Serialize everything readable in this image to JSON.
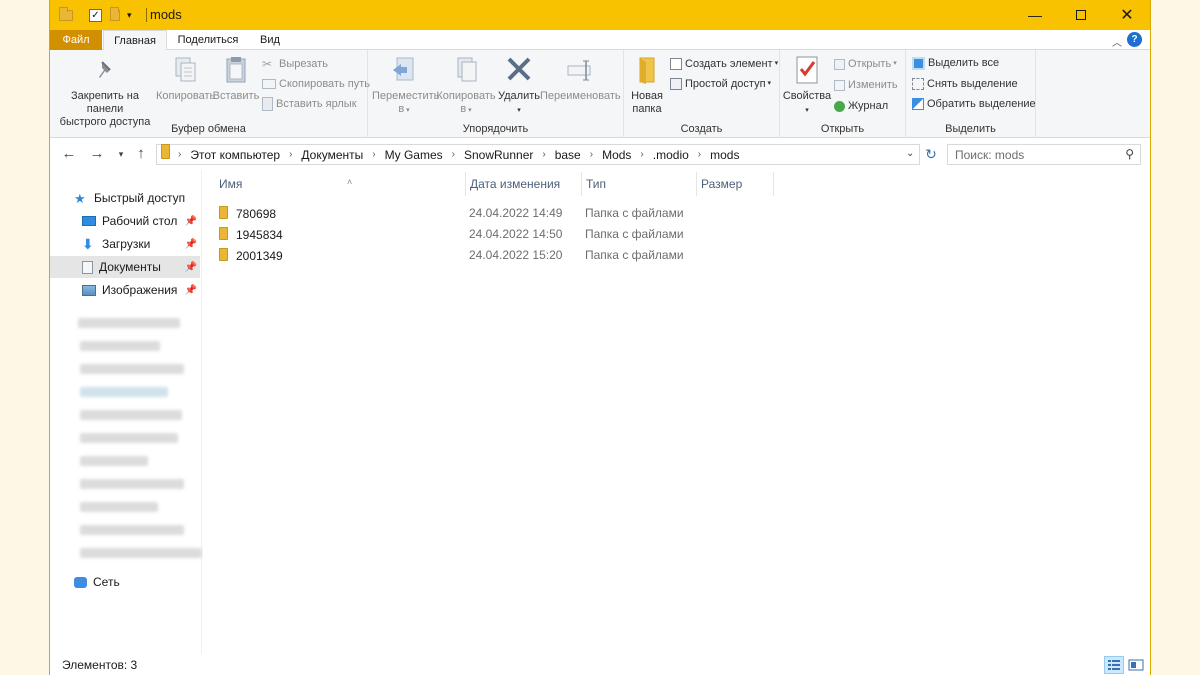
{
  "window": {
    "title": "mods"
  },
  "ribbon_tabs": [
    {
      "label": "Файл"
    },
    {
      "label": "Главная"
    },
    {
      "label": "Поделиться"
    },
    {
      "label": "Вид"
    }
  ],
  "ribbon": {
    "clipboard": {
      "label": "Буфер обмена",
      "pin_line1": "Закрепить на панели",
      "pin_line2": "быстрого доступа",
      "copy": "Копировать",
      "paste": "Вставить",
      "cut": "Вырезать",
      "copy_path": "Скопировать путь",
      "paste_shortcut": "Вставить ярлык"
    },
    "organize": {
      "label": "Упорядочить",
      "move_line1": "Переместить",
      "move_line2": "в",
      "copyto_line1": "Копировать",
      "copyto_line2": "в",
      "delete": "Удалить",
      "rename": "Переименовать"
    },
    "create": {
      "label": "Создать",
      "new_folder_line1": "Новая",
      "new_folder_line2": "папка",
      "new_item": "Создать элемент",
      "easy_access": "Простой доступ"
    },
    "open": {
      "label": "Открыть",
      "properties": "Свойства",
      "open": "Открыть",
      "edit": "Изменить",
      "history": "Журнал"
    },
    "select": {
      "label": "Выделить",
      "select_all": "Выделить все",
      "select_none": "Снять выделение",
      "invert": "Обратить выделение"
    }
  },
  "address": {
    "crumbs": [
      "Этот компьютер",
      "Документы",
      "My Games",
      "SnowRunner",
      "base",
      "Mods",
      ".modio",
      "mods"
    ]
  },
  "search": {
    "placeholder": "Поиск: mods"
  },
  "nav": {
    "quick_access": "Быстрый доступ",
    "items": [
      {
        "label": "Рабочий стол",
        "pinned": true
      },
      {
        "label": "Загрузки",
        "pinned": true
      },
      {
        "label": "Документы",
        "pinned": true,
        "selected": true
      },
      {
        "label": "Изображения",
        "pinned": true
      }
    ],
    "network": "Сеть"
  },
  "columns": {
    "name": "Имя",
    "date": "Дата изменения",
    "type": "Тип",
    "size": "Размер"
  },
  "files": [
    {
      "name": "780698",
      "date": "24.04.2022 14:49",
      "type": "Папка с файлами"
    },
    {
      "name": "1945834",
      "date": "24.04.2022 14:50",
      "type": "Папка с файлами"
    },
    {
      "name": "2001349",
      "date": "24.04.2022 15:20",
      "type": "Папка с файлами"
    }
  ],
  "status": {
    "count_text": "Элементов: 3"
  },
  "colors": {
    "titlebar": "#f8c200",
    "file_tab": "#d28f00",
    "folder": "#e9b636",
    "accent": "#1d6fd1"
  }
}
